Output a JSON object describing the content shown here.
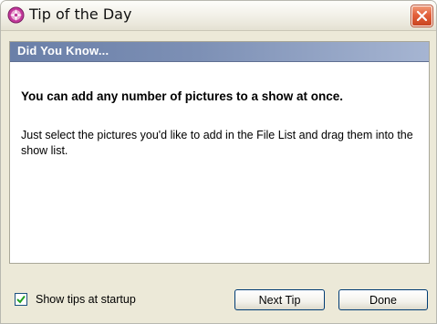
{
  "window": {
    "title": "Tip of the Day",
    "icon": "app-logo-icon",
    "close_icon": "close-icon"
  },
  "tip": {
    "header": "Did You Know...",
    "heading": "You can add any number of pictures to a show at once.",
    "body": "Just select the pictures you'd like to add in the File List and drag them into the show list."
  },
  "footer": {
    "show_tips_label": "Show tips at startup",
    "show_tips_checked": true,
    "next_tip_label": "Next Tip",
    "done_label": "Done"
  },
  "colors": {
    "header_band": "#7d90b5",
    "close_button": "#e2603a",
    "dialog_face": "#ece9d8"
  }
}
